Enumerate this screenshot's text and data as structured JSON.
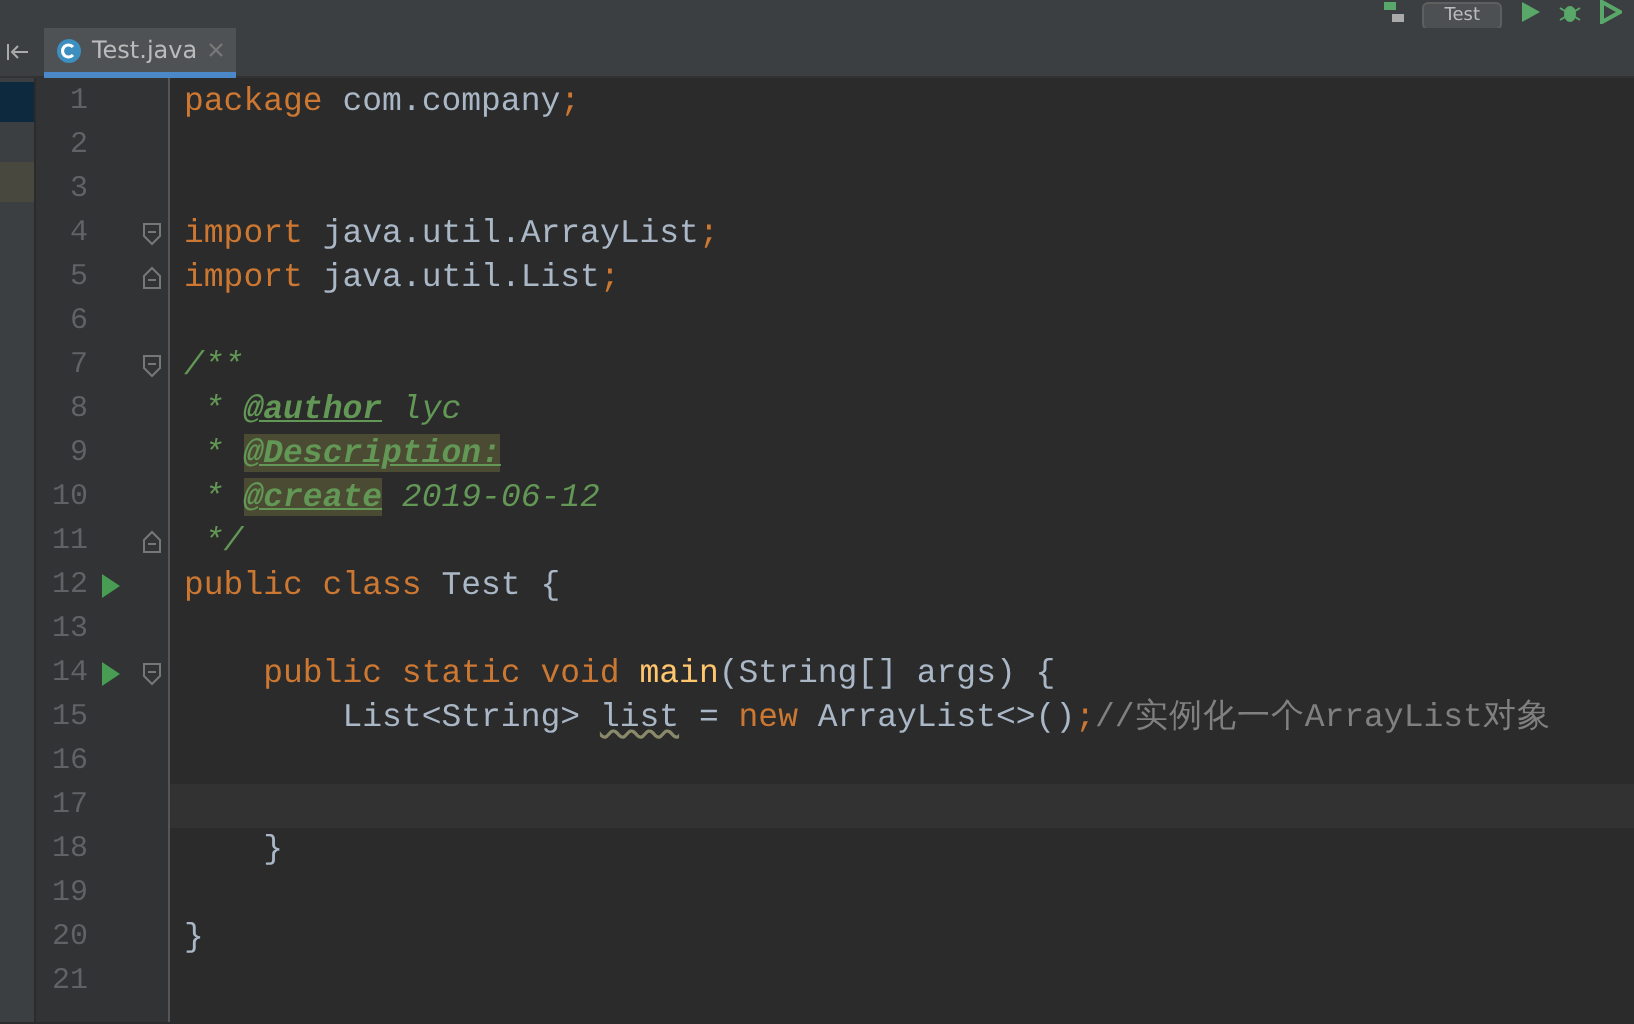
{
  "toolbar": {
    "run_config": "Test"
  },
  "tabs": [
    {
      "label": "Test.java",
      "selected": true
    }
  ],
  "lines": [
    {
      "number": "1",
      "run": false,
      "current": false,
      "tokens": [
        {
          "text": "package",
          "kind": "kw"
        },
        {
          "text": " com.company",
          "kind": "plain"
        },
        {
          "text": ";",
          "kind": "kw"
        }
      ]
    },
    {
      "number": "2",
      "run": false,
      "current": false
    },
    {
      "number": "3",
      "run": false,
      "current": false
    },
    {
      "number": "4",
      "run": false,
      "current": false,
      "fold": {
        "kind": "start"
      },
      "tokens": [
        {
          "text": "import",
          "kind": "kw"
        },
        {
          "text": " java.util.ArrayList",
          "kind": "plain"
        },
        {
          "text": ";",
          "kind": "kw"
        }
      ]
    },
    {
      "number": "5",
      "run": false,
      "current": false,
      "fold": {
        "kind": "end"
      },
      "tokens": [
        {
          "text": "import",
          "kind": "kw"
        },
        {
          "text": " java.util.List",
          "kind": "plain"
        },
        {
          "text": ";",
          "kind": "kw"
        }
      ]
    },
    {
      "number": "6",
      "run": false,
      "current": false
    },
    {
      "number": "7",
      "run": false,
      "current": false,
      "fold": {
        "kind": "start"
      },
      "tokens": [
        {
          "text": "/**",
          "kind": "doc"
        }
      ]
    },
    {
      "number": "8",
      "run": false,
      "current": false,
      "tokens": [
        {
          "text": " * ",
          "kind": "doc"
        },
        {
          "text": "@author",
          "kind": "doctag"
        },
        {
          "text": " lyc",
          "kind": "doc"
        }
      ]
    },
    {
      "number": "9",
      "run": false,
      "current": false,
      "tokens": [
        {
          "text": " * ",
          "kind": "doc"
        },
        {
          "text": "@Description:",
          "kind": "doctag-hl"
        }
      ]
    },
    {
      "number": "10",
      "run": false,
      "current": false,
      "tokens": [
        {
          "text": " * ",
          "kind": "doc"
        },
        {
          "text": "@create",
          "kind": "doctag-hl"
        },
        {
          "text": " 2019-06-12",
          "kind": "doc"
        }
      ]
    },
    {
      "number": "11",
      "run": false,
      "current": false,
      "fold": {
        "kind": "end"
      },
      "tokens": [
        {
          "text": " */",
          "kind": "doc"
        }
      ]
    },
    {
      "number": "12",
      "run": true,
      "current": false,
      "tokens": [
        {
          "text": "public class",
          "kind": "kw"
        },
        {
          "text": " Test {",
          "kind": "plain"
        }
      ]
    },
    {
      "number": "13",
      "run": false,
      "current": false
    },
    {
      "number": "14",
      "run": true,
      "current": false,
      "fold": {
        "kind": "start"
      },
      "tokens": [
        {
          "text": "    public static void ",
          "kind": "kw"
        },
        {
          "text": "main",
          "kind": "method"
        },
        {
          "text": "(String[] args) {",
          "kind": "plain"
        }
      ]
    },
    {
      "number": "15",
      "run": false,
      "current": false,
      "tokens": [
        {
          "text": "        List<String> ",
          "kind": "plain"
        },
        {
          "text": "list",
          "kind": "warn"
        },
        {
          "text": " = ",
          "kind": "plain"
        },
        {
          "text": "new",
          "kind": "kw"
        },
        {
          "text": " ArrayList<>()",
          "kind": "plain"
        },
        {
          "text": ";",
          "kind": "kw"
        },
        {
          "text": "//实例化一个ArrayList对象",
          "kind": "comment"
        }
      ]
    },
    {
      "number": "16",
      "run": false,
      "current": false
    },
    {
      "number": "17",
      "run": false,
      "current": true
    },
    {
      "number": "18",
      "run": false,
      "current": false,
      "tokens": [
        {
          "text": "    }",
          "kind": "plain"
        }
      ]
    },
    {
      "number": "19",
      "run": false,
      "current": false
    },
    {
      "number": "20",
      "run": false,
      "current": false,
      "tokens": [
        {
          "text": "}",
          "kind": "plain"
        }
      ]
    },
    {
      "number": "21",
      "run": false,
      "current": false
    }
  ]
}
